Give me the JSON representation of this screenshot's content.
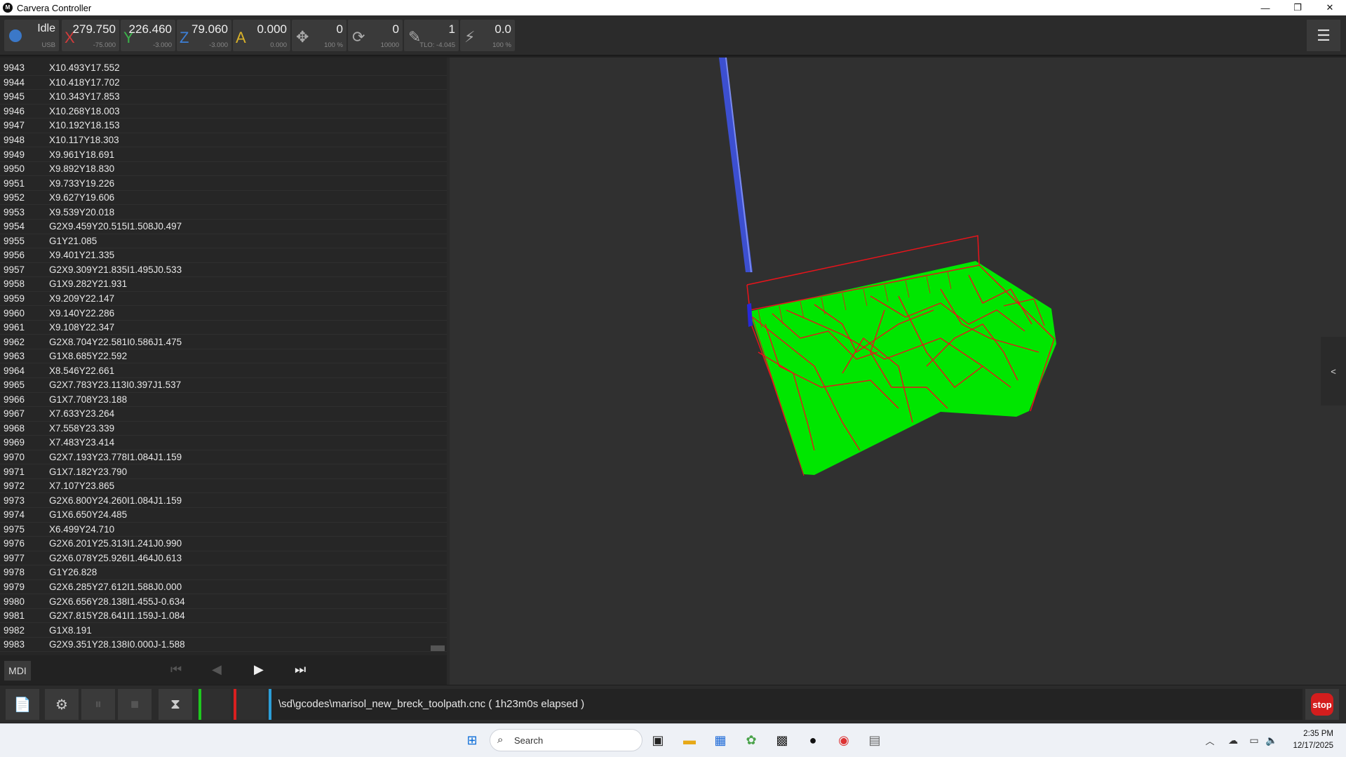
{
  "window": {
    "title": "Carvera Controller",
    "controls": [
      "—",
      "❐",
      "✕"
    ]
  },
  "status": {
    "state": "Idle",
    "connection": "USB",
    "state_color": "#3b78c8",
    "axes": [
      {
        "name": "X",
        "value": "279.750",
        "sub": "-75.000",
        "color": "#d23b3b"
      },
      {
        "name": "Y",
        "value": "226.460",
        "sub": "-3.000",
        "color": "#3bb24a"
      },
      {
        "name": "Z",
        "value": "79.060",
        "sub": "-3.000",
        "color": "#3d7fd6"
      },
      {
        "name": "A",
        "value": "0.000",
        "sub": "0.000",
        "color": "#d8b12a"
      }
    ],
    "feed": {
      "value": "0",
      "sub": "100 %",
      "icon": "move-icon"
    },
    "spindle": {
      "value": "0",
      "sub": "10000",
      "icon": "spindle-icon"
    },
    "tool": {
      "value": "1",
      "sub": "TLO: -4.045",
      "icon": "tool-icon"
    },
    "laser": {
      "value": "0.0",
      "sub": "100 %",
      "icon": "laser-icon"
    },
    "menu_icon": "☰"
  },
  "gcode": {
    "lines": [
      {
        "num": "9943",
        "code": "X10.493Y17.552"
      },
      {
        "num": "9944",
        "code": "X10.418Y17.702"
      },
      {
        "num": "9945",
        "code": "X10.343Y17.853"
      },
      {
        "num": "9946",
        "code": "X10.268Y18.003"
      },
      {
        "num": "9947",
        "code": "X10.192Y18.153"
      },
      {
        "num": "9948",
        "code": "X10.117Y18.303"
      },
      {
        "num": "9949",
        "code": "X9.961Y18.691"
      },
      {
        "num": "9950",
        "code": "X9.892Y18.830"
      },
      {
        "num": "9951",
        "code": "X9.733Y19.226"
      },
      {
        "num": "9952",
        "code": "X9.627Y19.606"
      },
      {
        "num": "9953",
        "code": "X9.539Y20.018"
      },
      {
        "num": "9954",
        "code": "G2X9.459Y20.515I1.508J0.497"
      },
      {
        "num": "9955",
        "code": "G1Y21.085"
      },
      {
        "num": "9956",
        "code": "X9.401Y21.335"
      },
      {
        "num": "9957",
        "code": "G2X9.309Y21.835I1.495J0.533"
      },
      {
        "num": "9958",
        "code": "G1X9.282Y21.931"
      },
      {
        "num": "9959",
        "code": "X9.209Y22.147"
      },
      {
        "num": "9960",
        "code": "X9.140Y22.286"
      },
      {
        "num": "9961",
        "code": "X9.108Y22.347"
      },
      {
        "num": "9962",
        "code": "G2X8.704Y22.581I0.586J1.475"
      },
      {
        "num": "9963",
        "code": "G1X8.685Y22.592"
      },
      {
        "num": "9964",
        "code": "X8.546Y22.661"
      },
      {
        "num": "9965",
        "code": "G2X7.783Y23.113I0.397J1.537"
      },
      {
        "num": "9966",
        "code": "G1X7.708Y23.188"
      },
      {
        "num": "9967",
        "code": "X7.633Y23.264"
      },
      {
        "num": "9968",
        "code": "X7.558Y23.339"
      },
      {
        "num": "9969",
        "code": "X7.483Y23.414"
      },
      {
        "num": "9970",
        "code": "G2X7.193Y23.778I1.084J1.159"
      },
      {
        "num": "9971",
        "code": "G1X7.182Y23.790"
      },
      {
        "num": "9972",
        "code": "X7.107Y23.865"
      },
      {
        "num": "9973",
        "code": "G2X6.800Y24.260I1.084J1.159"
      },
      {
        "num": "9974",
        "code": "G1X6.650Y24.485"
      },
      {
        "num": "9975",
        "code": "X6.499Y24.710"
      },
      {
        "num": "9976",
        "code": "G2X6.201Y25.313I1.241J0.990"
      },
      {
        "num": "9977",
        "code": "G2X6.078Y25.926I1.464J0.613"
      },
      {
        "num": "9978",
        "code": "G1Y26.828"
      },
      {
        "num": "9979",
        "code": "G2X6.285Y27.612I1.588J0.000"
      },
      {
        "num": "9980",
        "code": "G2X6.656Y28.138I1.455J-0.634"
      },
      {
        "num": "9981",
        "code": "G2X7.815Y28.641I1.159J-1.084"
      },
      {
        "num": "9982",
        "code": "G1X8.191"
      },
      {
        "num": "9983",
        "code": "G2X9.351Y28.138I0.000J-1.588"
      }
    ]
  },
  "controls": {
    "mdi_label": "MDI",
    "first": "⏮",
    "prev": "◀",
    "play": "▶",
    "last": "⏭"
  },
  "view": {
    "collapse_label": "<"
  },
  "job": {
    "file_label": "\\sd\\gcodes\\marisol_new_breck_toolpath.cnc ( 1h23m0s elapsed )",
    "stop_label": "stop"
  },
  "taskbar": {
    "search_placeholder": "Search",
    "time": "2:35 PM",
    "date": "12/17/2025"
  }
}
